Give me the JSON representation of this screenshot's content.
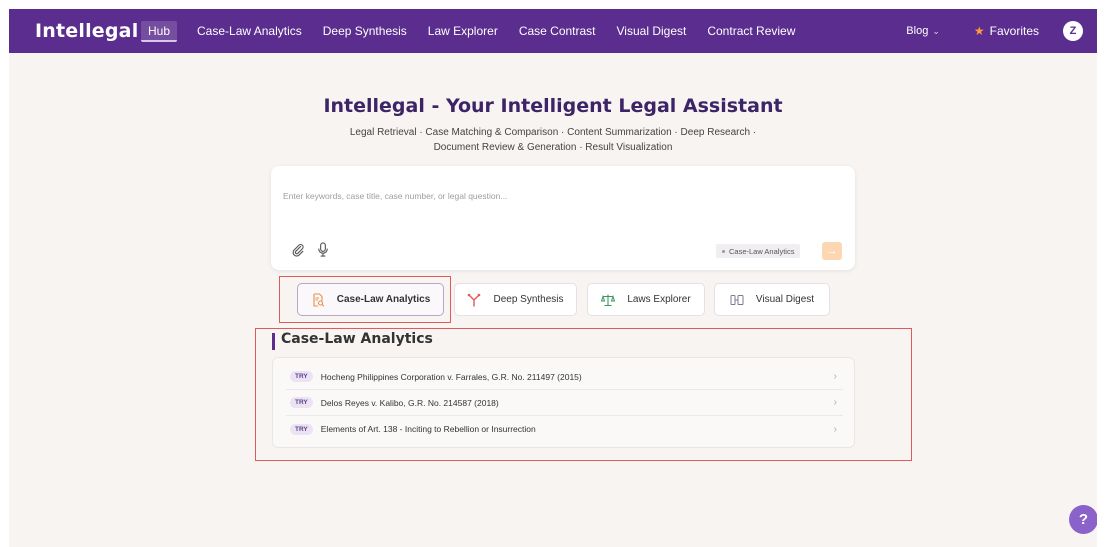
{
  "brand": "Intellegal",
  "nav": {
    "items": [
      {
        "label": "Hub",
        "active": true
      },
      {
        "label": "Case-Law Analytics"
      },
      {
        "label": "Deep Synthesis"
      },
      {
        "label": "Law Explorer"
      },
      {
        "label": "Case Contrast"
      },
      {
        "label": "Visual Digest"
      },
      {
        "label": "Contract Review"
      }
    ],
    "blog_label": "Blog",
    "favorites_label": "Favorites",
    "avatar_initial": "Z"
  },
  "hero": {
    "title": "Intellegal - Your Intelligent Legal Assistant",
    "subtitle": "Legal Retrieval · Case Matching & Comparison · Content Summarization · Deep Research · Document Review & Generation · Result Visualization"
  },
  "search": {
    "placeholder": "Enter keywords, case title, case number, or legal question...",
    "value": "",
    "mode_chip": "Case-Law Analytics",
    "send_icon": "arrow-right-icon"
  },
  "mode_tabs": [
    {
      "label": "Case-Law Analytics",
      "icon": "document-search-icon",
      "active": true
    },
    {
      "label": "Deep Synthesis",
      "icon": "merge-icon"
    },
    {
      "label": "Laws Explorer",
      "icon": "scales-icon"
    },
    {
      "label": "Visual Digest",
      "icon": "slides-icon"
    }
  ],
  "section": {
    "title": "Case-Law Analytics",
    "examples": [
      {
        "badge": "TRY",
        "text": "Hocheng Philippines Corporation v. Farrales, G.R. No. 211497 (2015)"
      },
      {
        "badge": "TRY",
        "text": "Delos Reyes v. Kalibo, G.R. No. 214587 (2018)"
      },
      {
        "badge": "TRY",
        "text": "Elements of Art. 138 - Inciting to Rebellion or Insurrection"
      }
    ]
  },
  "help_label": "?",
  "colors": {
    "nav_bg": "#5b2d8e",
    "accent_orange": "#ff9a3c",
    "highlight_red": "#e05a5a",
    "page_bg": "#f7f4f1"
  }
}
